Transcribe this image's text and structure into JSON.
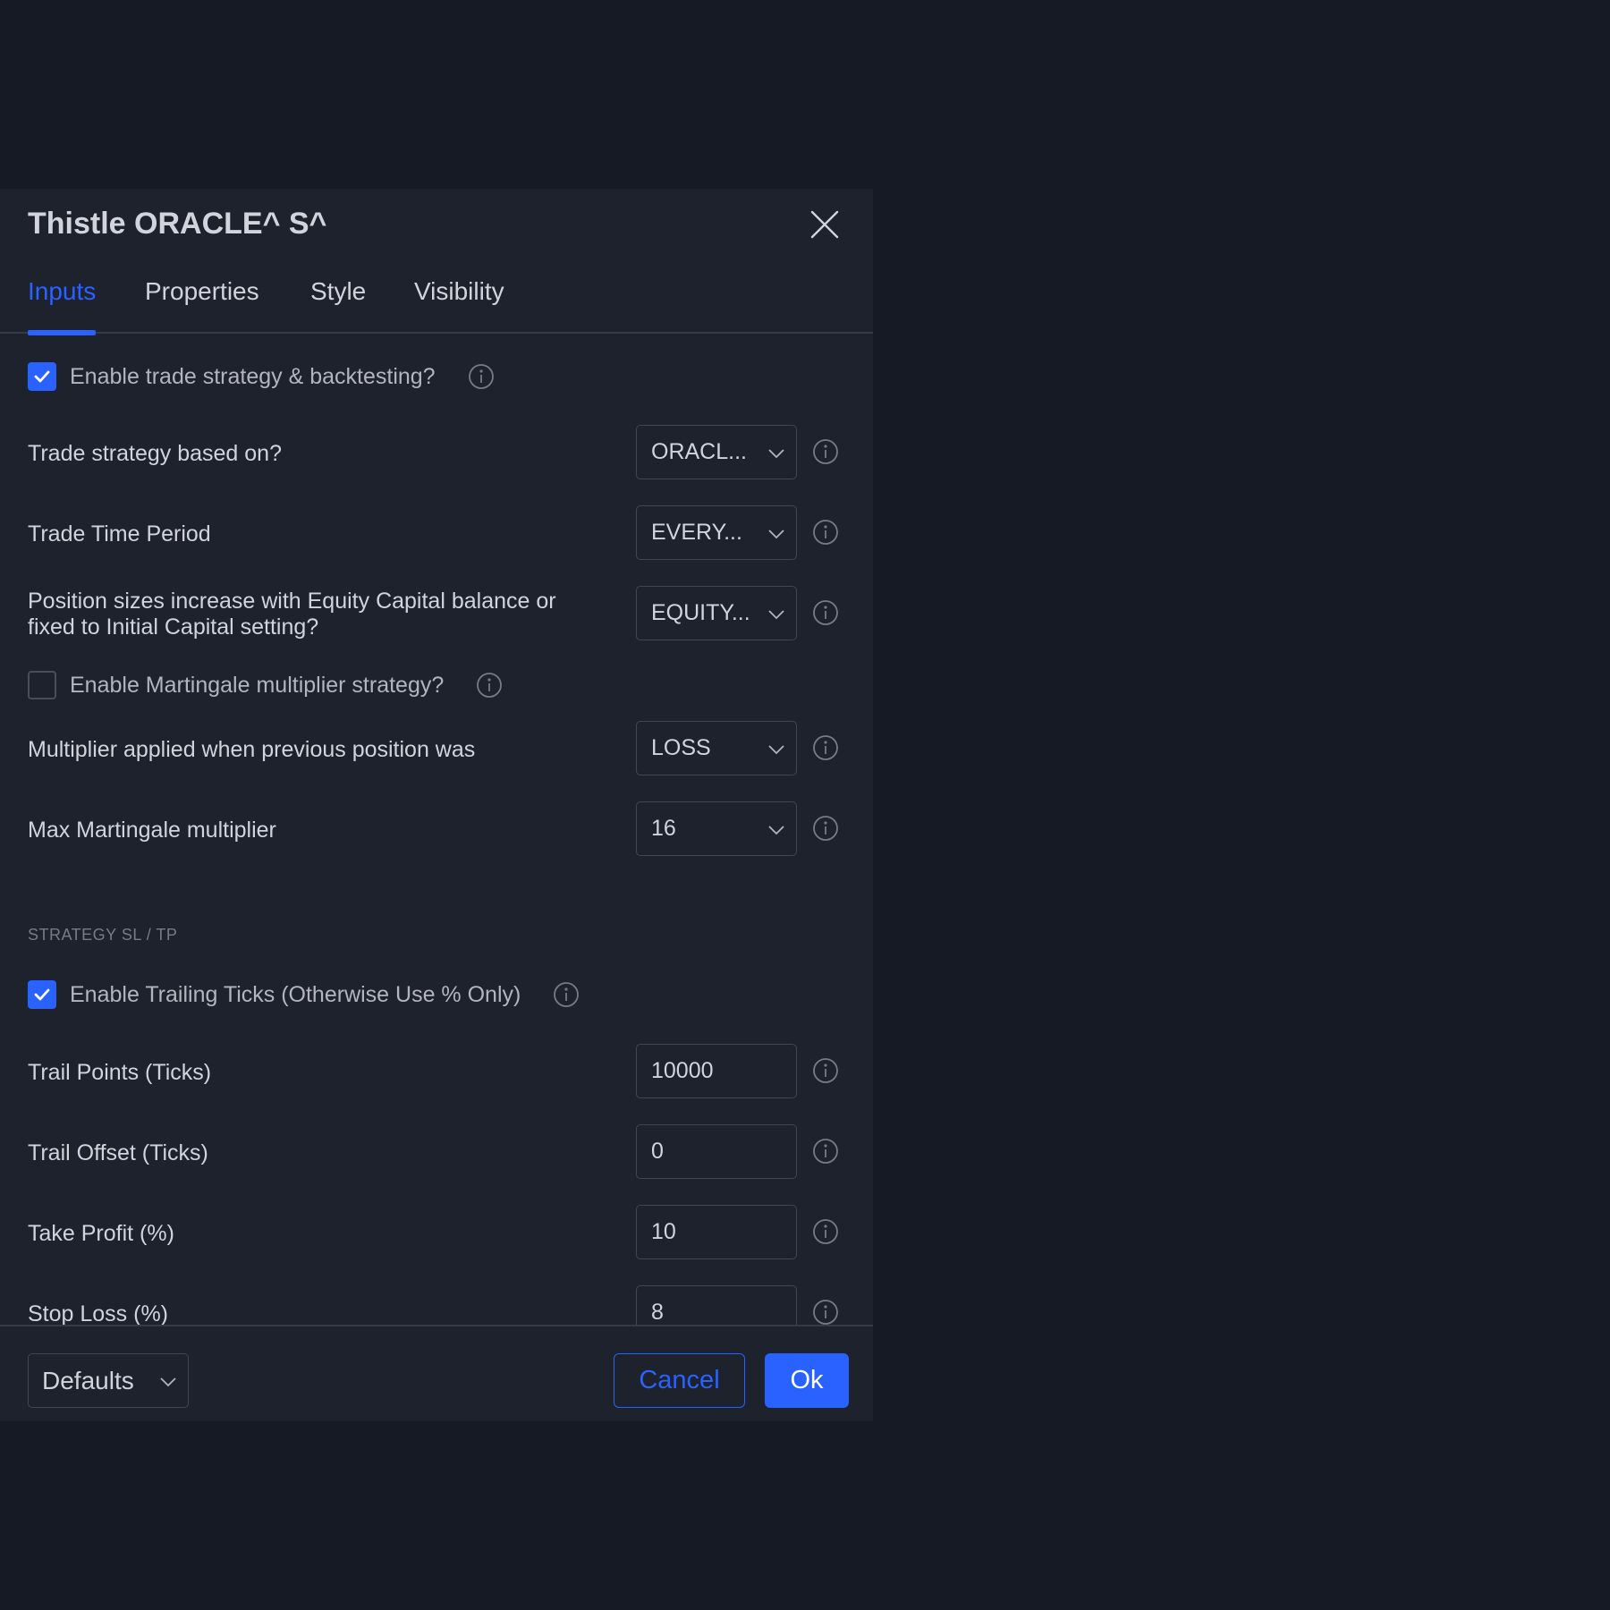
{
  "dialog": {
    "title": "Thistle ORACLE^ S^",
    "close_icon": "close-icon"
  },
  "tabs": [
    {
      "label": "Inputs",
      "active": true
    },
    {
      "label": "Properties",
      "active": false
    },
    {
      "label": "Style",
      "active": false
    },
    {
      "label": "Visibility",
      "active": false
    }
  ],
  "inputs": {
    "enable_strategy": {
      "label": "Enable trade strategy & backtesting?",
      "checked": true
    },
    "strategy_based_on": {
      "label": "Trade strategy based on?",
      "value": "ORACL..."
    },
    "trade_time_period": {
      "label": "Trade Time Period",
      "value": "EVERY..."
    },
    "position_sizes": {
      "label_line1": "Position sizes increase with Equity Capital balance or",
      "label_line2": "fixed to Initial Capital setting?",
      "value": "EQUITY..."
    },
    "enable_martingale": {
      "label": "Enable Martingale multiplier strategy?",
      "checked": false
    },
    "multiplier_applied": {
      "label": "Multiplier applied when previous position was",
      "value": "LOSS"
    },
    "max_martingale": {
      "label": "Max Martingale multiplier",
      "value": "16"
    },
    "section_sl_tp": "STRATEGY SL / TP",
    "enable_trailing": {
      "label": "Enable Trailing Ticks (Otherwise Use % Only)",
      "checked": true
    },
    "trail_points": {
      "label": "Trail Points (Ticks)",
      "value": "10000"
    },
    "trail_offset": {
      "label": "Trail Offset (Ticks)",
      "value": "0"
    },
    "take_profit": {
      "label": "Take Profit (%)",
      "value": "10"
    },
    "stop_loss": {
      "label": "Stop Loss (%)",
      "value": "8"
    }
  },
  "footer": {
    "defaults_label": "Defaults",
    "cancel_label": "Cancel",
    "ok_label": "Ok"
  },
  "colors": {
    "background": "#161a25",
    "dialog": "#1e222d",
    "accent": "#2962ff",
    "text": "#d1d4dc",
    "muted": "#787b86"
  }
}
